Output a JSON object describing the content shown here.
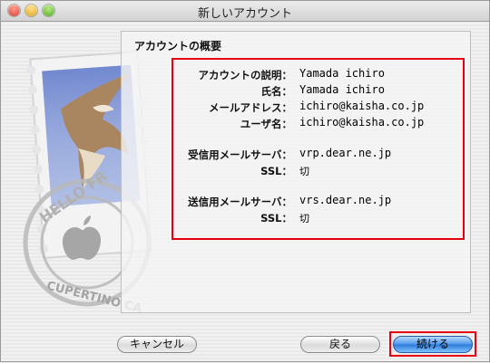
{
  "window": {
    "title": "新しいアカウント"
  },
  "stamp": {
    "text_top": "HELLO FR",
    "text_bottom": "CUPERTINO CA"
  },
  "panel": {
    "title": "アカウントの概要",
    "rows": [
      {
        "label": "アカウントの説明：",
        "value": "Yamada ichiro"
      },
      {
        "label": "氏名：",
        "value": "Yamada ichiro"
      },
      {
        "label": "メールアドレス：",
        "value": "ichiro@kaisha.co.jp"
      },
      {
        "label": "ユーザ名：",
        "value": "ichiro@kaisha.co.jp"
      },
      {
        "label": "受信用メールサーバ：",
        "value": "vrp.dear.ne.jp"
      },
      {
        "label": "SSL：",
        "value": "切"
      },
      {
        "label": "送信用メールサーバ：",
        "value": "vrs.dear.ne.jp"
      },
      {
        "label": "SSL：",
        "value": "切"
      }
    ]
  },
  "buttons": {
    "cancel": "キャンセル",
    "back": "戻る",
    "continue": "続ける"
  },
  "colors": {
    "highlight": "#e60012",
    "primary_button": "#2c79d9"
  }
}
